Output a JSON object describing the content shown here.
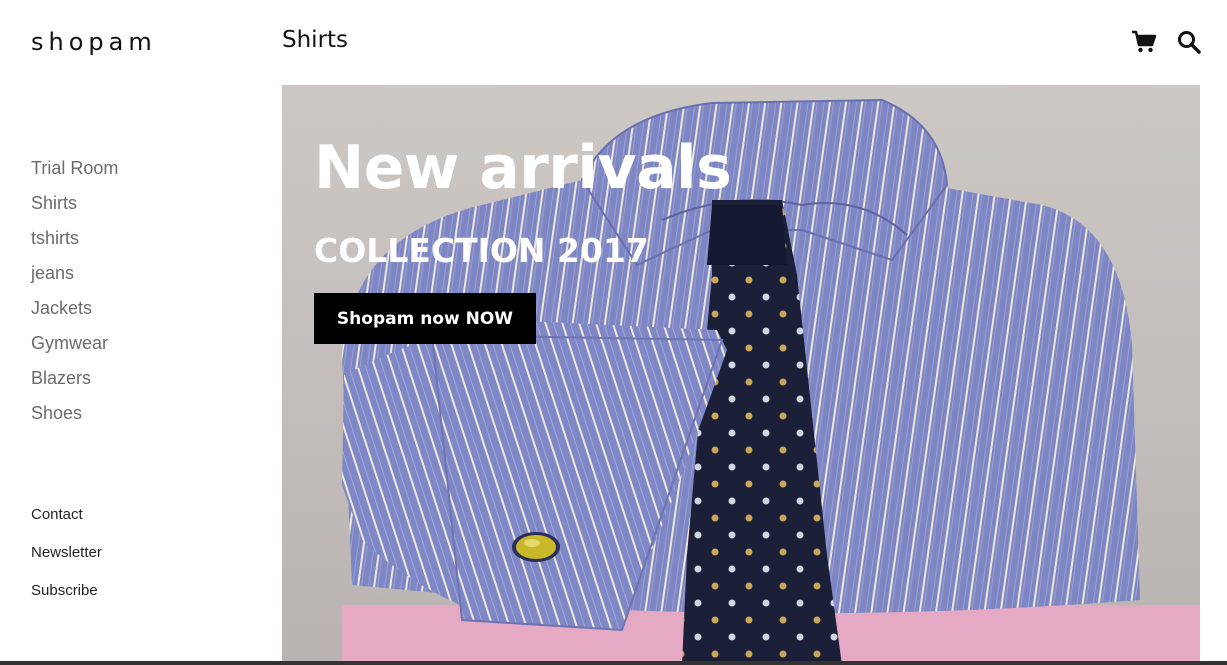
{
  "brand": {
    "logo": "shopam"
  },
  "header": {
    "page_title": "Shirts",
    "cart_icon": "cart-icon",
    "search_icon": "search-icon"
  },
  "sidebar": {
    "categories": [
      {
        "label": "Trial Room"
      },
      {
        "label": "Shirts"
      },
      {
        "label": "tshirts"
      },
      {
        "label": "jeans"
      },
      {
        "label": "Jackets"
      },
      {
        "label": "Gymwear"
      },
      {
        "label": "Blazers"
      },
      {
        "label": "Shoes"
      }
    ],
    "secondary": [
      {
        "label": "Contact"
      },
      {
        "label": "Newsletter"
      },
      {
        "label": "Subscribe"
      }
    ]
  },
  "hero": {
    "title": "New arrivals",
    "subtitle": "COLLECTION 2017",
    "cta_label": "Shopam now NOW"
  },
  "colors": {
    "shirt": "#7f86c4",
    "stripe": "#e9e6dc",
    "tie": "#1a1f3a",
    "background": "#cfcac6",
    "button": "#000000"
  }
}
